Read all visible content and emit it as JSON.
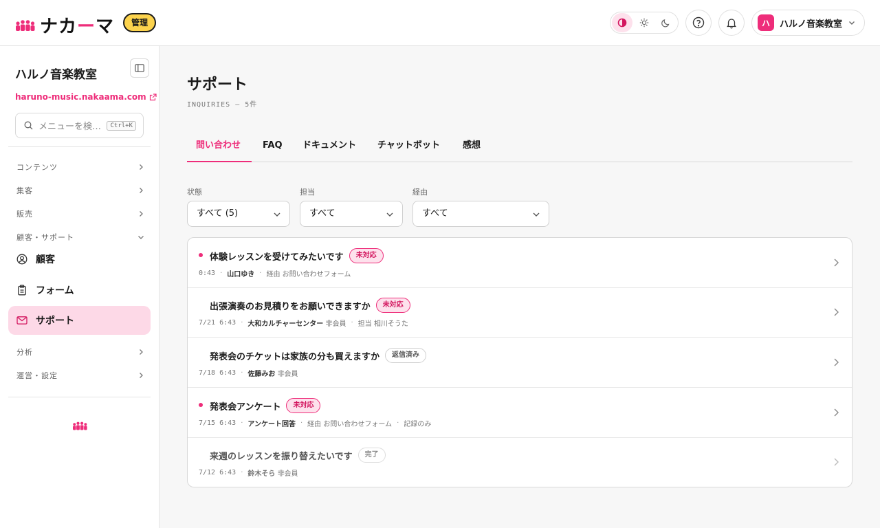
{
  "app": {
    "brand_pre": "ナカ",
    "brand_dash": "ー",
    "brand_post": "マ",
    "admin_badge": "管理",
    "accent": "#ee2d7a"
  },
  "header": {
    "theme_options": [
      "contrast-icon",
      "sun-icon",
      "moon-icon"
    ],
    "account_initial": "ハ",
    "account_name": "ハルノ音楽教室"
  },
  "sidebar": {
    "title": "ハルノ音楽教室",
    "site_link": "haruno-music.nakaama.com",
    "search_placeholder": "メニューを検…",
    "search_shortcut": "Ctrl+K",
    "sections": [
      {
        "label": "コンテンツ"
      },
      {
        "label": "集客"
      },
      {
        "label": "販売"
      },
      {
        "label": "顧客・サポート"
      }
    ],
    "items": [
      {
        "label": "顧客",
        "icon": "user-circle-icon"
      },
      {
        "label": "フォーム",
        "icon": "clipboard-icon"
      },
      {
        "label": "サポート",
        "icon": "mail-icon"
      }
    ],
    "sections_after": [
      {
        "label": "分析"
      },
      {
        "label": "運営・設定"
      }
    ]
  },
  "main": {
    "title": "サポート",
    "subtitle": "INQUIRIES — 5件",
    "tabs": [
      "問い合わせ",
      "FAQ",
      "ドキュメント",
      "チャットボット",
      "感想"
    ],
    "filters": [
      {
        "label": "状態",
        "value": "すべて (5)"
      },
      {
        "label": "担当",
        "value": "すべて"
      },
      {
        "label": "経由",
        "value": "すべて"
      }
    ],
    "inquiries": [
      {
        "title": "体験レッスンを受けてみたいです",
        "status": "未対応",
        "time": "0:43",
        "who": "山口ゆき",
        "member": "",
        "extra": [
          "経由 お問い合わせフォーム"
        ]
      },
      {
        "title": "出張演奏のお見積りをお願いできますか",
        "status": "未対応",
        "time": "7/21 6:43",
        "who": "大和カルチャーセンター",
        "member": "非会員",
        "extra": [
          "担当 相川そうた"
        ]
      },
      {
        "title": "発表会のチケットは家族の分も買えますか",
        "status": "返信済み",
        "time": "7/18 6:43",
        "who": "佐藤みお",
        "member": "非会員",
        "extra": []
      },
      {
        "title": "発表会アンケート",
        "status": "未対応",
        "time": "7/15 6:43",
        "who": "アンケート回答",
        "member": "",
        "extra": [
          "経由 お問い合わせフォーム",
          "記録のみ"
        ]
      },
      {
        "title": "来週のレッスンを振り替えたいです",
        "status": "完了",
        "time": "7/12 6:43",
        "who": "鈴木そら",
        "member": "非会員",
        "extra": []
      }
    ]
  }
}
